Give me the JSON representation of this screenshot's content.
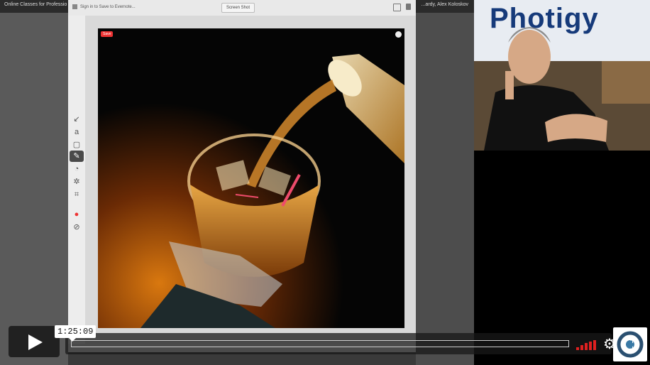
{
  "desktop": {
    "window_title": "Online Classes for Professio",
    "user_label": "...ardy, Alex Koloskov"
  },
  "evernote": {
    "signin_label": "Sign in to Save to Evernote...",
    "screenshot_type": "Screen Shot",
    "tools": [
      "arrow-tool-icon",
      "text-tool-icon",
      "rectangle-tool-icon",
      "marker-tool-icon",
      "highlighter-tool-icon",
      "stamp-tool-icon",
      "crop-tool-icon",
      "color-picker-icon",
      "size-picker-icon"
    ],
    "save_badge": "Save"
  },
  "webcam": {
    "banner_text": "Photigy"
  },
  "player": {
    "timecode": "1:25:09",
    "progress": 0.0,
    "volume_level": 5,
    "accent_color": "#e02020"
  }
}
